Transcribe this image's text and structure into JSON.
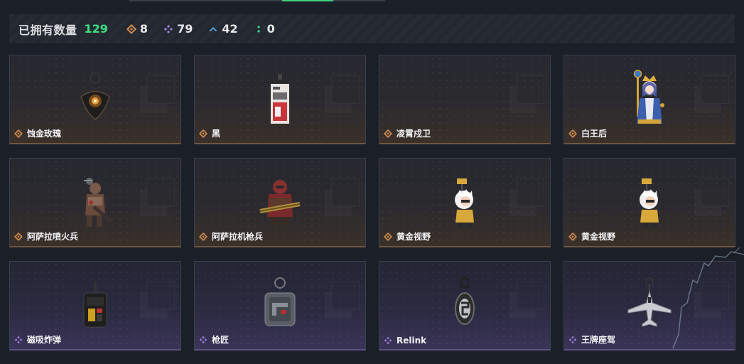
{
  "tabs_indicator": "active-tab-underline",
  "stats": {
    "owned_label": "已拥有数量",
    "owned_count": "129",
    "rarities": [
      {
        "icon": "gold-rarity-icon",
        "count": "8",
        "color": "#d08a4e"
      },
      {
        "icon": "purple-rarity-icon",
        "count": "79",
        "color": "#a27de0"
      },
      {
        "icon": "blue-rarity-icon",
        "count": "42",
        "color": "#5aa6e6"
      },
      {
        "icon": "green-rarity-icon",
        "count": "0",
        "color": "#3fd89a"
      }
    ]
  },
  "items": [
    {
      "name": "蚀金玫瑰",
      "rarity": "gold",
      "icon": "rose-pendant-charm-icon"
    },
    {
      "name": "黑",
      "rarity": "gold",
      "icon": "card-charm-icon"
    },
    {
      "name": "凌霄戍卫",
      "rarity": "gold",
      "icon": ""
    },
    {
      "name": "白王后",
      "rarity": "gold",
      "icon": "queen-figure-charm-icon"
    },
    {
      "name": "阿萨拉喷火兵",
      "rarity": "gold",
      "icon": "flamethrower-soldier-charm-icon"
    },
    {
      "name": "阿萨拉机枪兵",
      "rarity": "gold",
      "icon": "machine-gunner-charm-icon"
    },
    {
      "name": "黄金视野",
      "rarity": "gold",
      "icon": "golden-view-figure-charm-icon"
    },
    {
      "name": "黄金视野",
      "rarity": "gold",
      "icon": "golden-view-figure-charm-icon"
    },
    {
      "name": "磁吸炸弹",
      "rarity": "purple",
      "icon": "magnetic-bomb-charm-icon"
    },
    {
      "name": "枪匠",
      "rarity": "purple",
      "icon": "gunsmith-dogtag-charm-icon"
    },
    {
      "name": "Relink",
      "rarity": "purple",
      "icon": "relink-pendant-charm-icon"
    },
    {
      "name": "王牌座驾",
      "rarity": "purple",
      "icon": "fighter-jet-charm-icon"
    }
  ],
  "colors": {
    "gold": "#d08a4e",
    "purple": "#a27de0",
    "accent_green": "#3ee07f"
  }
}
